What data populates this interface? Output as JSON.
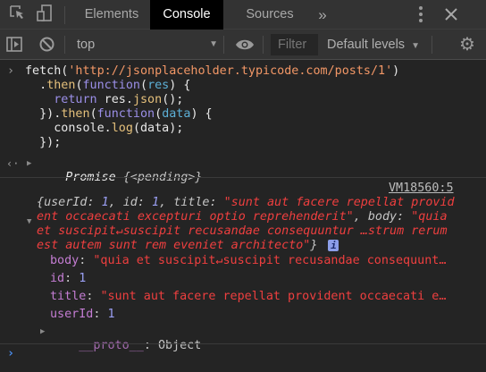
{
  "tabs": [
    {
      "label": "Elements"
    },
    {
      "label": "Console",
      "active": true
    },
    {
      "label": "Sources"
    }
  ],
  "more_tabs": "»",
  "toolbar": {
    "context": "top",
    "filter_placeholder": "Filter",
    "levels": "Default levels"
  },
  "code": [
    [
      [
        "plain",
        "fetch("
      ],
      [
        "str",
        "'http://jsonplaceholder.typicode.com/posts/1'"
      ],
      [
        "plain",
        ")"
      ]
    ],
    [
      [
        "plain",
        "  ."
      ],
      [
        "fn",
        "then"
      ],
      [
        "plain",
        "("
      ],
      [
        "kw",
        "function"
      ],
      [
        "plain",
        "("
      ],
      [
        "param",
        "res"
      ],
      [
        "plain",
        ") {"
      ]
    ],
    [
      [
        "plain",
        "    "
      ],
      [
        "kw",
        "return"
      ],
      [
        "plain",
        " res."
      ],
      [
        "fn",
        "json"
      ],
      [
        "plain",
        "();"
      ]
    ],
    [
      [
        "plain",
        "  })."
      ],
      [
        "fn",
        "then"
      ],
      [
        "plain",
        "("
      ],
      [
        "kw",
        "function"
      ],
      [
        "plain",
        "("
      ],
      [
        "param",
        "data"
      ],
      [
        "plain",
        ") {"
      ]
    ],
    [
      [
        "plain",
        "    console."
      ],
      [
        "fn",
        "log"
      ],
      [
        "plain",
        "(data);"
      ]
    ],
    [
      [
        "plain",
        "  });"
      ]
    ]
  ],
  "result": {
    "label": "Promise",
    "value": "{<pending>}"
  },
  "log": {
    "source": "VM18560:5",
    "summary": {
      "open": "{",
      "k1": "userId",
      "v1": "1",
      "k2": "id",
      "v2": "1",
      "k3": "title",
      "v3": "\"sunt aut facere repellat provident occaecati excepturi optio reprehenderit\"",
      "k4": "body",
      "v4": "\"quia et suscipit↵suscipit recusandae consequuntur …strum rerum est autem sunt rem eveniet architecto\"",
      "close": "}"
    },
    "info_badge": "i",
    "props": [
      {
        "key": "body",
        "value": "\"quia et suscipit↵suscipit recusandae consequunt…",
        "type": "str"
      },
      {
        "key": "id",
        "value": "1",
        "type": "num"
      },
      {
        "key": "title",
        "value": "\"sunt aut facere repellat provident occaecati e…",
        "type": "str"
      },
      {
        "key": "userId",
        "value": "1",
        "type": "num"
      }
    ],
    "proto": {
      "key": "__proto__",
      "value": "Object"
    }
  }
}
